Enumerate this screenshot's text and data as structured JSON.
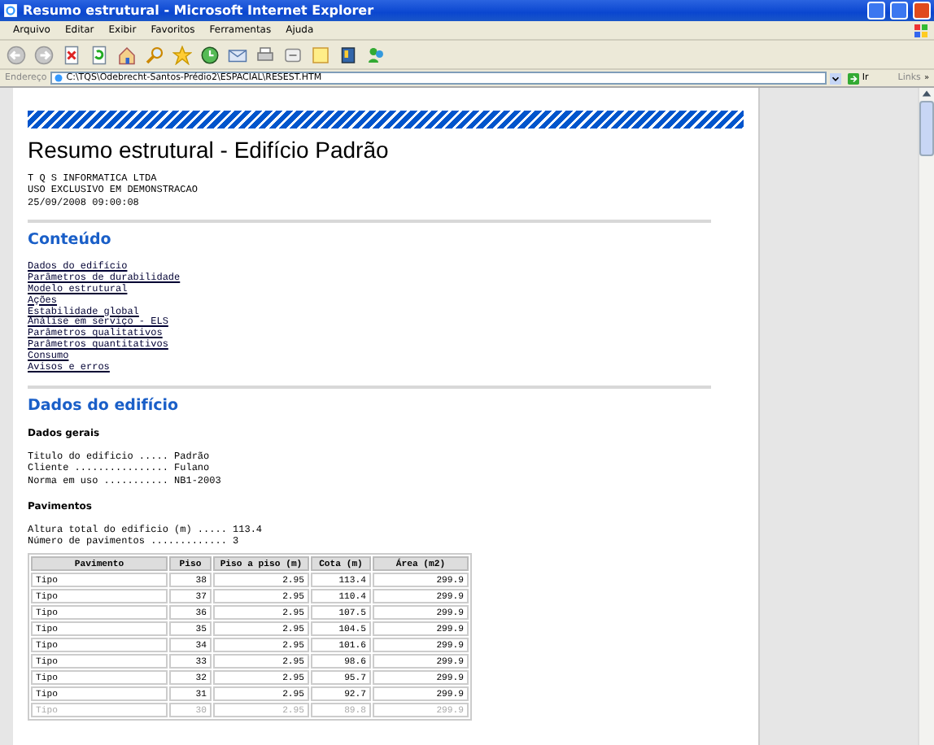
{
  "window": {
    "title": "Resumo estrutural - Microsoft Internet Explorer"
  },
  "menu": [
    "Arquivo",
    "Editar",
    "Exibir",
    "Favoritos",
    "Ferramentas",
    "Ajuda"
  ],
  "address": {
    "label": "Endereço",
    "value": "C:\\TQS\\Odebrecht-Santos-Prédio2\\ESPACIAL\\RESEST.HTM",
    "go": "Ir",
    "links": "Links",
    "more": "»"
  },
  "document": {
    "title": "Resumo estrutural - Edifício Padrão",
    "header_lines": [
      "T Q S INFORMATICA LTDA",
      "USO EXCLUSIVO EM DEMONSTRACAO",
      "25/09/2008 09:00:08"
    ],
    "contents": {
      "heading": "Conteúdo",
      "links": [
        "Dados do edifício",
        "Parâmetros de durabilidade",
        "Modelo estrutural",
        "Ações",
        "Estabilidade global",
        "Análise em serviço - ELS",
        "Parâmetros qualitativos",
        "Parâmetros quantitativos",
        "Consumo",
        "Avisos e erros"
      ]
    },
    "section": {
      "heading": "Dados do edifício",
      "general": {
        "heading": "Dados gerais",
        "lines": [
          "Titulo do edificio ..... Padrão",
          "Cliente ................ Fulano",
          "Norma em uso ........... NB1-2003"
        ]
      },
      "floors": {
        "heading": "Pavimentos",
        "lines": [
          "Altura total do edificio (m) ..... 113.4",
          "Número de pavimentos ............. 3"
        ],
        "table": {
          "columns": [
            "Pavimento",
            "Piso",
            "Piso a piso (m)",
            "Cota (m)",
            "Área (m2)"
          ],
          "rows": [
            [
              "Tipo",
              "38",
              "2.95",
              "113.4",
              "299.9"
            ],
            [
              "Tipo",
              "37",
              "2.95",
              "110.4",
              "299.9"
            ],
            [
              "Tipo",
              "36",
              "2.95",
              "107.5",
              "299.9"
            ],
            [
              "Tipo",
              "35",
              "2.95",
              "104.5",
              "299.9"
            ],
            [
              "Tipo",
              "34",
              "2.95",
              "101.6",
              "299.9"
            ],
            [
              "Tipo",
              "33",
              "2.95",
              "98.6",
              "299.9"
            ],
            [
              "Tipo",
              "32",
              "2.95",
              "95.7",
              "299.9"
            ],
            [
              "Tipo",
              "31",
              "2.95",
              "92.7",
              "299.9"
            ],
            [
              "Tipo",
              "30",
              "2.95",
              "89.8",
              "299.9"
            ]
          ]
        }
      }
    }
  }
}
